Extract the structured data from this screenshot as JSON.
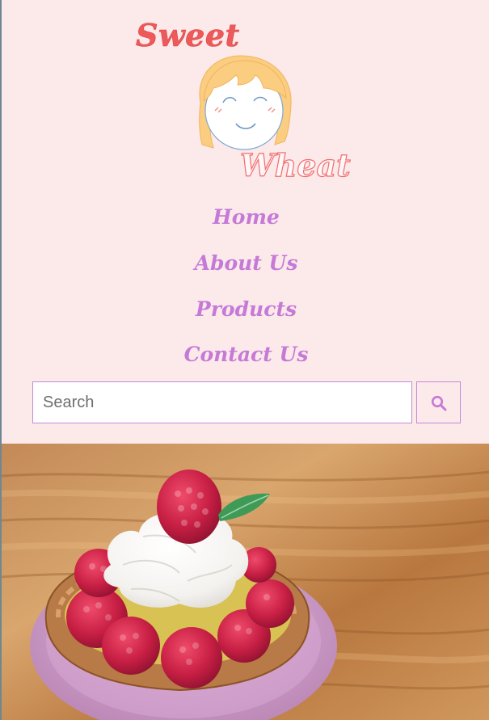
{
  "brand": {
    "word_top": "Sweet",
    "word_bottom": "Wheat",
    "logo_icon": "girl-face-logo"
  },
  "nav": {
    "items": [
      {
        "label": "Home"
      },
      {
        "label": "About Us"
      },
      {
        "label": "Products"
      },
      {
        "label": "Contact Us"
      }
    ]
  },
  "search": {
    "placeholder": "Search",
    "value": "",
    "button_icon": "search-icon"
  },
  "hero": {
    "image": "raspberry-cream-tart-photo"
  },
  "colors": {
    "background": "#fce9ea",
    "nav_text": "#c57ad7",
    "brand_red": "#ee5a59",
    "border": "#c58ad8"
  }
}
